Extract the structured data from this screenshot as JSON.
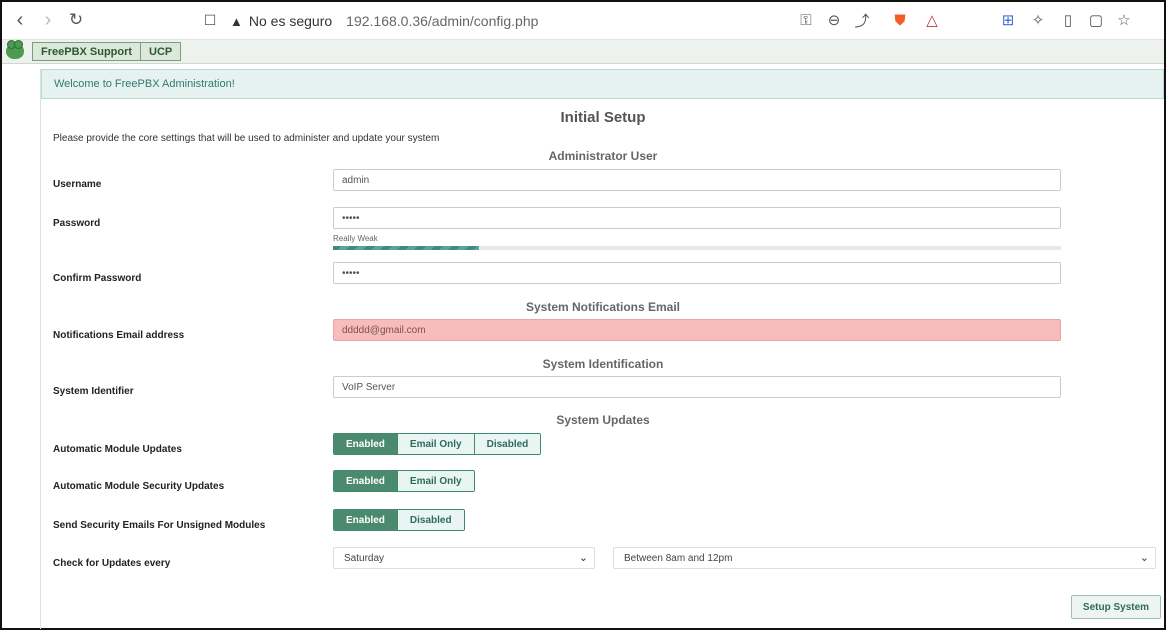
{
  "browser": {
    "security_text": "No es seguro",
    "url": "192.168.0.36/admin/config.php"
  },
  "topbar": {
    "support_label": "FreePBX Support",
    "ucp_label": "UCP"
  },
  "welcome_text": "Welcome to FreePBX Administration!",
  "page_title": "Initial Setup",
  "intro_text": "Please provide the core settings that will be used to administer and update your system",
  "sections": {
    "admin": "Administrator User",
    "notifications": "System Notifications Email",
    "identification": "System Identification",
    "updates": "System Updates"
  },
  "fields": {
    "username": {
      "label": "Username",
      "value": "admin"
    },
    "password": {
      "label": "Password",
      "value": "•••••"
    },
    "password_strength": {
      "label": "Really Weak",
      "level": 0.2
    },
    "confirm_password": {
      "label": "Confirm Password",
      "value": "•••••"
    },
    "email": {
      "label": "Notifications Email address",
      "value": "ddddd@gmail.com"
    },
    "system_identifier": {
      "label": "System Identifier",
      "value": "VoIP Server"
    }
  },
  "updates": {
    "auto_module": {
      "label": "Automatic Module Updates",
      "options": [
        "Enabled",
        "Email Only",
        "Disabled"
      ],
      "selected": "Enabled"
    },
    "auto_security": {
      "label": "Automatic Module Security Updates",
      "options": [
        "Enabled",
        "Email Only"
      ],
      "selected": "Enabled"
    },
    "unsigned_emails": {
      "label": "Send Security Emails For Unsigned Modules",
      "options": [
        "Enabled",
        "Disabled"
      ],
      "selected": "Enabled"
    },
    "check_every": {
      "label": "Check for Updates every",
      "day": "Saturday",
      "time": "Between 8am and 12pm"
    }
  },
  "setup_button": "Setup System",
  "colors": {
    "accent": "#4b8a6e",
    "error_bg": "#f8bcbc",
    "welcome_bg": "#e6f2f0"
  }
}
